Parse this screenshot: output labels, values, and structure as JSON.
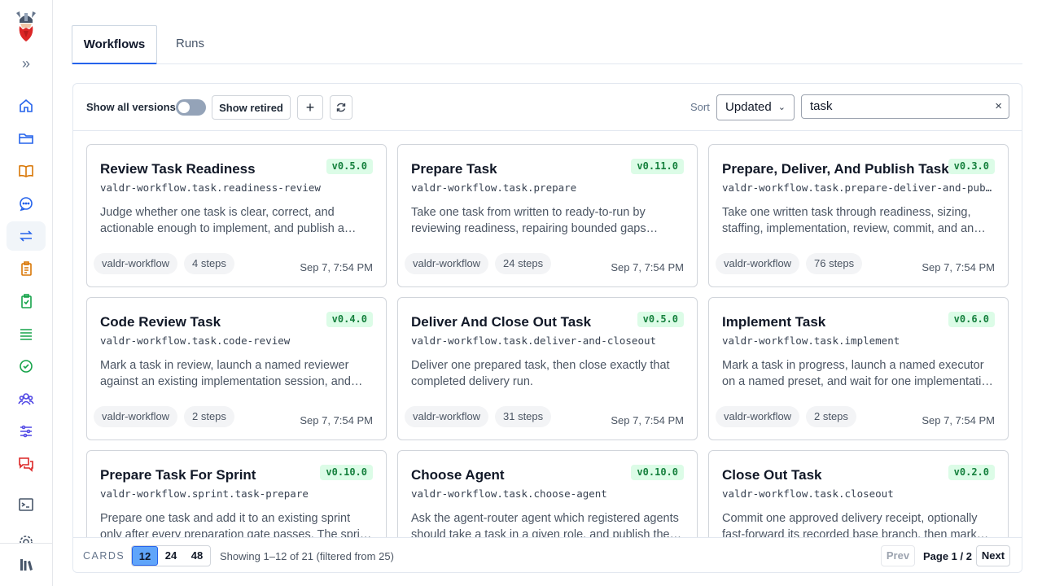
{
  "tabs": [
    {
      "label": "Workflows",
      "active": true
    },
    {
      "label": "Runs",
      "active": false
    }
  ],
  "sidebar": {
    "icons": [
      "home-icon",
      "folder-icon",
      "book-icon",
      "chat-icon",
      "workflow-arrows-icon",
      "clipboard-icon",
      "clipboard-check-icon",
      "list-icon",
      "check-circle-icon",
      "team-icon",
      "sliders-icon",
      "messages-icon",
      "terminal-icon",
      "settings-icon"
    ],
    "bottom_icon": "app-library-icon"
  },
  "toolbar": {
    "show_all_versions_label": "Show all versions",
    "show_all_versions_on": false,
    "show_retired_label": "Show retired",
    "add_label": "+",
    "sort_label": "Sort",
    "sort_value": "Updated",
    "search_value": "task",
    "search_clear": "×"
  },
  "cards": [
    {
      "title": "Review Task Readiness",
      "version": "v0.5.0",
      "slug": "valdr-workflow.task.readiness-review",
      "description": "Judge whether one task is clear, correct, and actionable enough to implement, and publish a…",
      "package": "valdr-workflow",
      "steps": "4 steps",
      "updated": "Sep 7, 7:54 PM"
    },
    {
      "title": "Prepare Task",
      "version": "v0.11.0",
      "slug": "valdr-workflow.task.prepare",
      "description": "Take one task from written to ready-to-run by reviewing readiness, repairing bounded gaps once…",
      "package": "valdr-workflow",
      "steps": "24 steps",
      "updated": "Sep 7, 7:54 PM"
    },
    {
      "title": "Prepare, Deliver, And Publish Task",
      "version": "v0.3.0",
      "slug": "valdr-workflow.task.prepare-deliver-and-publi…",
      "description": "Take one written task through readiness, sizing, staffing, implementation, review, commit, and an…",
      "package": "valdr-workflow",
      "steps": "76 steps",
      "updated": "Sep 7, 7:54 PM"
    },
    {
      "title": "Code Review Task",
      "version": "v0.4.0",
      "slug": "valdr-workflow.task.code-review",
      "description": "Mark a task in review, launch a named reviewer against an existing implementation session, and…",
      "package": "valdr-workflow",
      "steps": "2 steps",
      "updated": "Sep 7, 7:54 PM"
    },
    {
      "title": "Deliver And Close Out Task",
      "version": "v0.5.0",
      "slug": "valdr-workflow.task.deliver-and-closeout",
      "description": "Deliver one prepared task, then close exactly that completed delivery run.",
      "package": "valdr-workflow",
      "steps": "31 steps",
      "updated": "Sep 7, 7:54 PM"
    },
    {
      "title": "Implement Task",
      "version": "v0.6.0",
      "slug": "valdr-workflow.task.implement",
      "description": "Mark a task in progress, launch a named executor on a named preset, and wait for one implementati…",
      "package": "valdr-workflow",
      "steps": "2 steps",
      "updated": "Sep 7, 7:54 PM"
    },
    {
      "title": "Prepare Task For Sprint",
      "version": "v0.10.0",
      "slug": "valdr-workflow.sprint.task-prepare",
      "description": "Prepare one task and add it to an existing sprint only after every preparation gate passes. The spri…",
      "package": "valdr-workflow",
      "steps": "",
      "updated": ""
    },
    {
      "title": "Choose Agent",
      "version": "v0.10.0",
      "slug": "valdr-workflow.task.choose-agent",
      "description": "Ask the agent-router agent which registered agents should take a task in a given role, and publish the…",
      "package": "valdr-workflow",
      "steps": "",
      "updated": ""
    },
    {
      "title": "Close Out Task",
      "version": "v0.2.0",
      "slug": "valdr-workflow.task.closeout",
      "description": "Commit one approved delivery receipt, optionally fast-forward its recorded base branch, then mark…",
      "package": "valdr-workflow",
      "steps": "",
      "updated": ""
    }
  ],
  "footer": {
    "cards_label": "CARDS",
    "sizes": [
      "12",
      "24",
      "48"
    ],
    "active_size": "12",
    "showing": "Showing 1–12 of 21 (filtered from 25)",
    "prev_label": "Prev",
    "page_info": "Page 1 / 2",
    "next_label": "Next"
  }
}
